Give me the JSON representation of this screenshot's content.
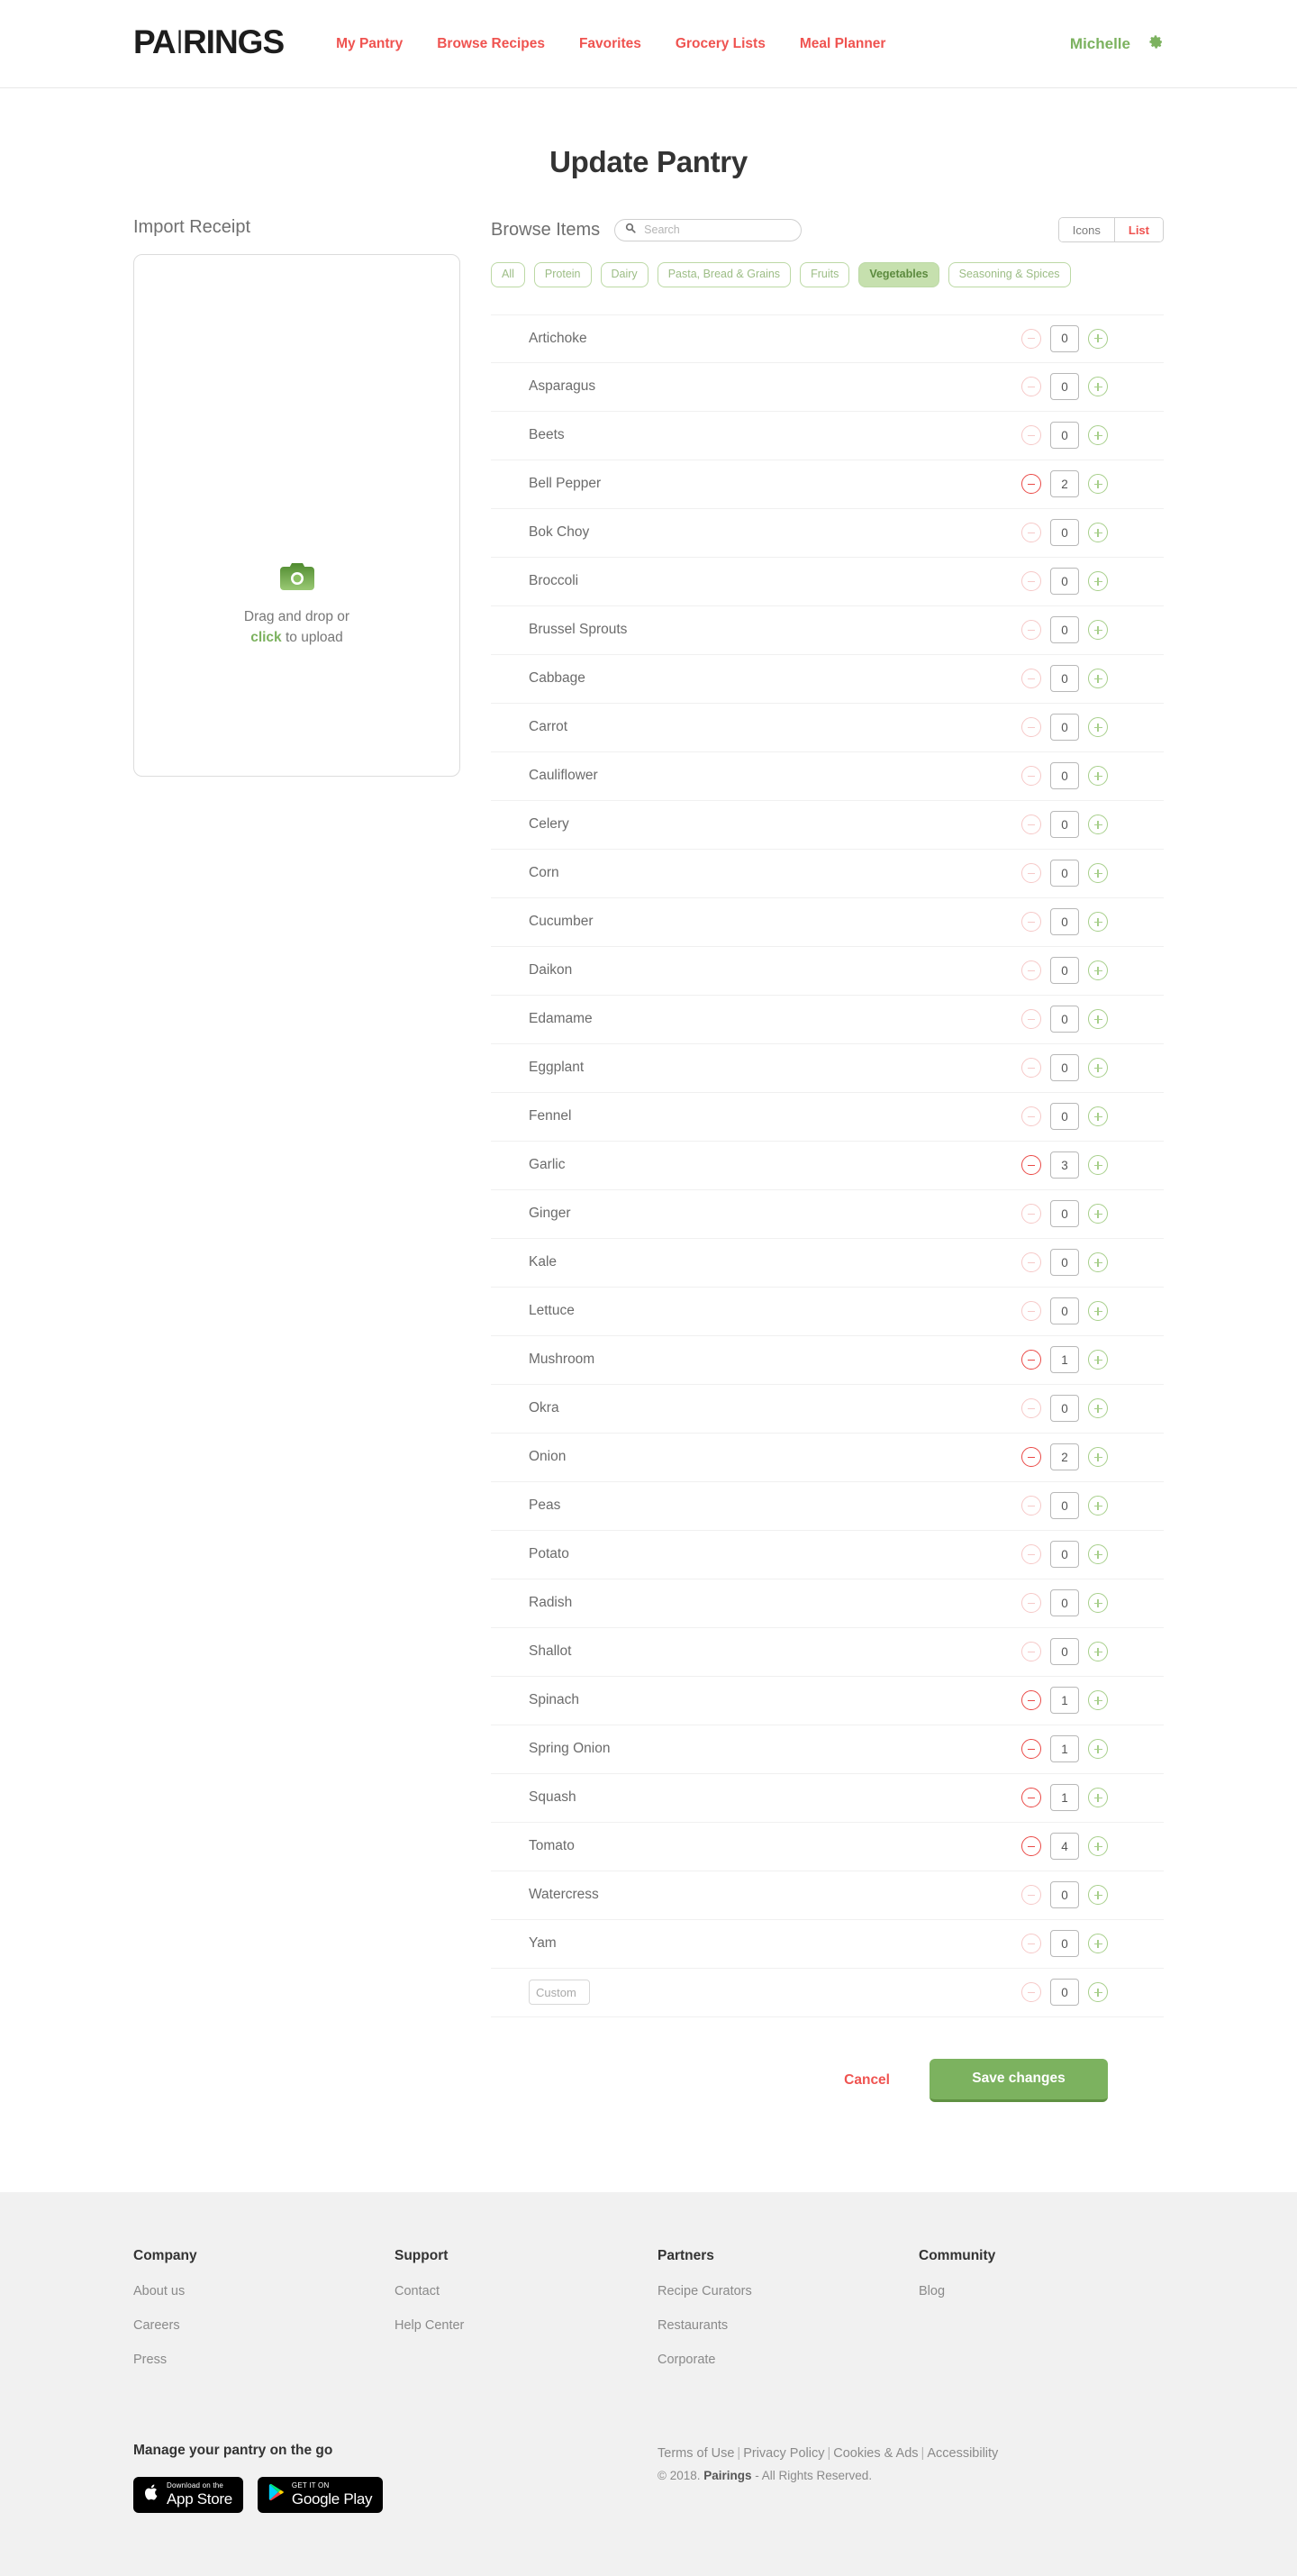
{
  "brand": {
    "logo_text_before": "PA",
    "logo_fork": "I",
    "logo_text_after": "RINGS",
    "accent_red": "#ef5350",
    "accent_green": "#7cb25f"
  },
  "header": {
    "nav": [
      {
        "label": "My Pantry"
      },
      {
        "label": "Browse Recipes"
      },
      {
        "label": "Favorites"
      },
      {
        "label": "Grocery Lists"
      },
      {
        "label": "Meal Planner"
      }
    ],
    "user_name": "Michelle",
    "settings_icon": "gear-icon"
  },
  "page": {
    "title": "Update Pantry"
  },
  "import": {
    "label": "Import Receipt",
    "icon": "camera-icon",
    "line1": "Drag and drop or",
    "click_word": "click",
    "line2": " to upload"
  },
  "browse": {
    "title": "Browse Items",
    "search": {
      "value": "",
      "placeholder": "Search",
      "icon": "search-icon"
    },
    "view_modes": [
      {
        "label": "Icons",
        "active": false
      },
      {
        "label": "List",
        "active": true
      }
    ],
    "chips": [
      {
        "label": "All",
        "active": false
      },
      {
        "label": "Protein",
        "active": false
      },
      {
        "label": "Dairy",
        "active": false
      },
      {
        "label": "Pasta, Bread & Grains",
        "active": false
      },
      {
        "label": "Fruits",
        "active": false
      },
      {
        "label": "Vegetables",
        "active": true
      },
      {
        "label": "Seasoning & Spices",
        "active": false
      }
    ]
  },
  "items": [
    {
      "name": "Artichoke",
      "qty": "0"
    },
    {
      "name": "Asparagus",
      "qty": "0"
    },
    {
      "name": "Beets",
      "qty": "0"
    },
    {
      "name": "Bell Pepper",
      "qty": "2"
    },
    {
      "name": "Bok Choy",
      "qty": "0"
    },
    {
      "name": "Broccoli",
      "qty": "0"
    },
    {
      "name": "Brussel Sprouts",
      "qty": "0"
    },
    {
      "name": "Cabbage",
      "qty": "0"
    },
    {
      "name": "Carrot",
      "qty": "0"
    },
    {
      "name": "Cauliflower",
      "qty": "0"
    },
    {
      "name": "Celery",
      "qty": "0"
    },
    {
      "name": "Corn",
      "qty": "0"
    },
    {
      "name": "Cucumber",
      "qty": "0"
    },
    {
      "name": "Daikon",
      "qty": "0"
    },
    {
      "name": "Edamame",
      "qty": "0"
    },
    {
      "name": "Eggplant",
      "qty": "0"
    },
    {
      "name": "Fennel",
      "qty": "0"
    },
    {
      "name": "Garlic",
      "qty": "3"
    },
    {
      "name": "Ginger",
      "qty": "0"
    },
    {
      "name": "Kale",
      "qty": "0"
    },
    {
      "name": "Lettuce",
      "qty": "0"
    },
    {
      "name": "Mushroom",
      "qty": "1"
    },
    {
      "name": "Okra",
      "qty": "0"
    },
    {
      "name": "Onion",
      "qty": "2"
    },
    {
      "name": "Peas",
      "qty": "0"
    },
    {
      "name": "Potato",
      "qty": "0"
    },
    {
      "name": "Radish",
      "qty": "0"
    },
    {
      "name": "Shallot",
      "qty": "0"
    },
    {
      "name": "Spinach",
      "qty": "1"
    },
    {
      "name": "Spring Onion",
      "qty": "1"
    },
    {
      "name": "Squash",
      "qty": "1"
    },
    {
      "name": "Tomato",
      "qty": "4"
    },
    {
      "name": "Watercress",
      "qty": "0"
    },
    {
      "name": "Yam",
      "qty": "0"
    }
  ],
  "custom_row": {
    "placeholder": "Custom",
    "value": "",
    "qty": "0"
  },
  "actions": {
    "cancel_label": "Cancel",
    "save_label": "Save changes"
  },
  "footer": {
    "columns": [
      {
        "heading": "Company",
        "links": [
          {
            "label": "About us"
          },
          {
            "label": "Careers"
          },
          {
            "label": "Press"
          }
        ]
      },
      {
        "heading": "Support",
        "links": [
          {
            "label": "Contact"
          },
          {
            "label": "Help Center"
          }
        ]
      },
      {
        "heading": "Partners",
        "links": [
          {
            "label": "Recipe Curators"
          },
          {
            "label": "Restaurants"
          },
          {
            "label": "Corporate"
          }
        ]
      },
      {
        "heading": "Community",
        "links": [
          {
            "label": "Blog"
          }
        ]
      }
    ],
    "tagline": "Manage your pantry on the go",
    "badges": [
      {
        "small": "Download on the",
        "big": "App Store",
        "icon": "apple-icon"
      },
      {
        "small": "GET IT ON",
        "big": "Google Play",
        "icon": "google-play-icon"
      }
    ],
    "legal_links": [
      {
        "label": "Terms of Use"
      },
      {
        "label": "Privacy Policy"
      },
      {
        "label": "Cookies & Ads"
      },
      {
        "label": "Accessibility"
      }
    ],
    "copyright_prefix": "© 2018. ",
    "copyright_brand": "Pairings",
    "copyright_suffix": " - All Rights Reserved."
  }
}
